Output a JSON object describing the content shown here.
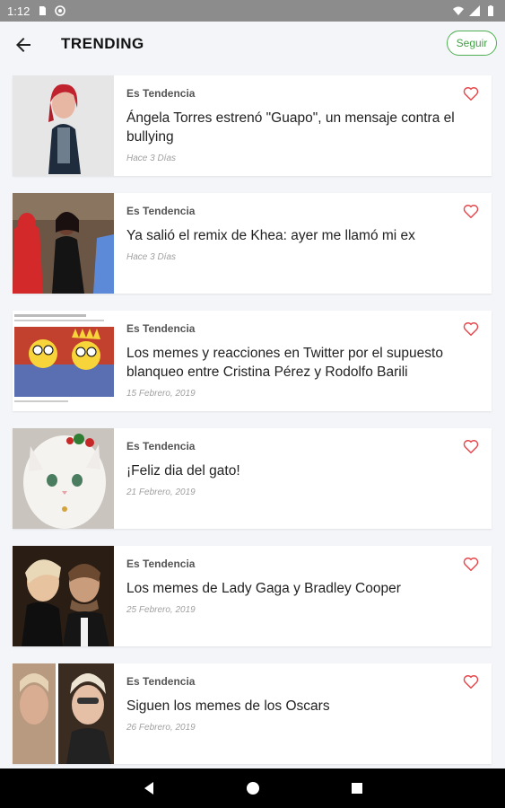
{
  "status_bar": {
    "time": "1:12"
  },
  "header": {
    "title": "TRENDING",
    "follow_label": "Seguir"
  },
  "articles": [
    {
      "tag": "Es Tendencia",
      "title": "Ángela Torres estrenó \"Guapo\", un mensaje contra el bullying",
      "date": "Hace 3 Días"
    },
    {
      "tag": "Es Tendencia",
      "title": "Ya salió el remix de Khea: ayer me llamó mi ex",
      "date": "Hace 3 Días"
    },
    {
      "tag": "Es Tendencia",
      "title": "Los memes y reacciones en Twitter por el supuesto blanqueo entre Cristina Pérez y Rodolfo Barili",
      "date": "15 Febrero, 2019"
    },
    {
      "tag": "Es Tendencia",
      "title": "¡Feliz dia del gato!",
      "date": "21 Febrero, 2019"
    },
    {
      "tag": "Es Tendencia",
      "title": "Los memes de Lady Gaga y Bradley Cooper",
      "date": "25 Febrero, 2019"
    },
    {
      "tag": "Es Tendencia",
      "title": "Siguen los memes de los Oscars",
      "date": "26 Febrero, 2019"
    }
  ],
  "icons": {
    "back": "arrow-left-icon",
    "favorite": "heart-outline-icon",
    "nav": [
      "back-triangle-icon",
      "home-circle-icon",
      "recents-square-icon"
    ]
  },
  "colors": {
    "accent": "#43a047",
    "heart": "#e5484d",
    "background": "#f3f5f8"
  }
}
